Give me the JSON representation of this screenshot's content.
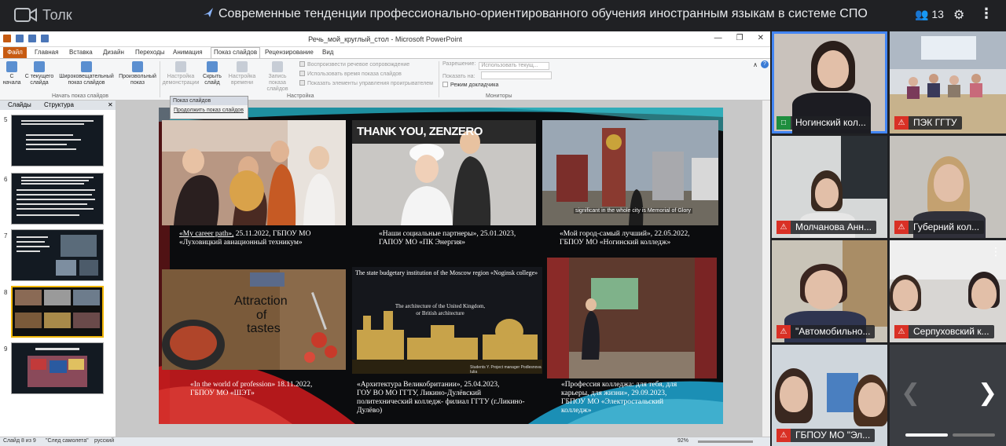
{
  "app": {
    "brand": "Толк",
    "meeting_title": "Современные тенденции профессионально-ориентированного обучения иностранным языкам в системе СПО",
    "participants_count": "13"
  },
  "ppt": {
    "doc_title": "Речь_мой_круглый_стол - Microsoft PowerPoint",
    "tabs": [
      "Файл",
      "Главная",
      "Вставка",
      "Дизайн",
      "Переходы",
      "Анимация",
      "Показ слайдов",
      "Рецензирование",
      "Вид"
    ],
    "active_tab": "Показ слайдов",
    "ribbon": {
      "from_start": "С начала",
      "from_current": "С текущего слайда",
      "broadcast": "Широковещательный показ слайдов",
      "custom": "Произвольный показ",
      "group_start": "Начать показ слайдов",
      "setup": "Настройка демонстрации",
      "hide": "Скрыть слайд",
      "rehearse": "Настройка времени",
      "record": "Запись показа слайдов",
      "opt1": "Воспроизвести речевое сопровождение",
      "opt2": "Использовать время показа слайдов",
      "opt3": "Показать элементы управления проигрывателем",
      "group_setup": "Настройка",
      "resolution_label": "Разрешение:",
      "resolution_value": "Использовать текущ...",
      "show_on_label": "Показать на:",
      "presenter_view": "Режим докладчика",
      "group_monitors": "Мониторы"
    },
    "panel_tabs": [
      "Слайды",
      "Структура"
    ],
    "slide_numbers": [
      "5",
      "6",
      "7",
      "8",
      "9"
    ],
    "popup": {
      "title": "Показ слайдов",
      "item": "Продолжить показ слайдов"
    },
    "status": {
      "slide": "Слайд 8 из 9",
      "theme": "\"След самолета\"",
      "lang": "русский",
      "zoom": "92%"
    }
  },
  "slide": {
    "p1_text": "THANK YOU, ZENZERO",
    "p3_sign": "significant in the whole city is Memorial of Glory",
    "p4_text1": "Attraction",
    "p4_text2": "of",
    "p4_text3": "tastes",
    "p5_head": "The state budgetary institution of the Moscow region «Noginsk college»",
    "p5_sub": "The architecture of the United Kingdom, or British architecture",
    "p5_foot": "Students Y. Project manager Podlesnova Iulia",
    "captions": [
      {
        "a": "«My career path»,",
        "b": "25.11.2022, ГБПОУ МО",
        "c": "«Луховицкий авиационный техникум»"
      },
      {
        "a": "«Наши социальные партнеры», 25.01.2023,",
        "b": "ГАПОУ МО «ПК Энергия»"
      },
      {
        "a": "«Мой город-самый лучший», 22.05.2022,",
        "b": "ГБПОУ МО «Ногинский колледж»"
      },
      {
        "a": "«In the world of profession» 18.11.2022,",
        "b": "ГБПОУ МО «ШЭТ»"
      },
      {
        "a": "«Архитектура Великобритании», 25.04.2023,",
        "b": "ГОУ ВО МО ГГТУ, Ликино-Дулёвский",
        "c": "политехнический колледж- филиал ГГТУ (г.Ликино-",
        "d": "Дулёво)"
      },
      {
        "a": "«Профессия колледжа: для тебя, для",
        "b": "карьеры, для жизни», 29.09.2023,",
        "c": "ГБПОУ МО «Электростальский",
        "d": "колледж»"
      }
    ]
  },
  "participants": [
    {
      "name": "Ногинский кол...",
      "mic": "on"
    },
    {
      "name": "ПЭК ГГТУ",
      "mic": "off"
    },
    {
      "name": "Молчанова Анн...",
      "mic": "off"
    },
    {
      "name": "Губерний кол...",
      "mic": "off"
    },
    {
      "name": "\"Автомобильно...",
      "mic": "off"
    },
    {
      "name": "Серпуховский к...",
      "mic": "off"
    },
    {
      "name": "ГБПОУ МО \"Эл...",
      "mic": "off"
    }
  ],
  "colors": {
    "accent": "#4285f4",
    "mic_off": "#d93025",
    "ppt_file_tab": "#c75b12",
    "selection": "#f2b705"
  }
}
